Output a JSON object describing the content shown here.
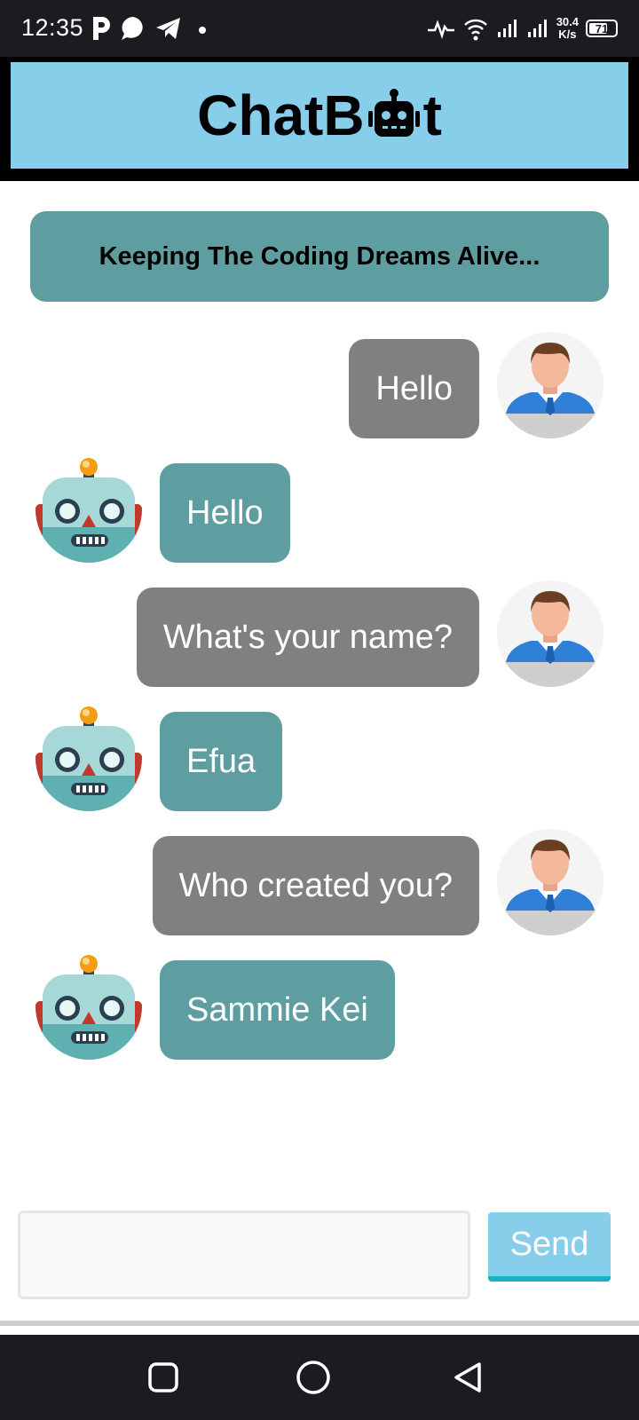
{
  "status_bar": {
    "time": "12:35",
    "net_speed_value": "30.4",
    "net_speed_unit": "K/s",
    "battery": "71",
    "icons": [
      "parking-icon",
      "chat-bubble-icon",
      "telegram-icon",
      "dot-icon",
      "activity-icon",
      "wifi-icon",
      "signal-1-icon",
      "signal-2-icon",
      "battery-icon"
    ]
  },
  "header": {
    "title_before": "ChatB",
    "title_after": "t",
    "robot_icon": "robot-face-icon"
  },
  "tagline": "Keeping The Coding Dreams Alive...",
  "messages": [
    {
      "sender": "user",
      "text": "Hello"
    },
    {
      "sender": "bot",
      "text": "Hello"
    },
    {
      "sender": "user",
      "text": "What's your name?"
    },
    {
      "sender": "bot",
      "text": "Efua"
    },
    {
      "sender": "user",
      "text": "Who created you?"
    },
    {
      "sender": "bot",
      "text": "Sammie Kei"
    }
  ],
  "input": {
    "value": "",
    "placeholder": ""
  },
  "send_button_label": "Send",
  "colors": {
    "header_bg": "#87ceeb",
    "tagline_bg": "#5f9ea0",
    "user_bubble": "#808080",
    "bot_bubble": "#5f9ea0",
    "send_bg": "#87ceeb",
    "system_bar": "#1c1b20"
  },
  "nav_bar": {
    "icons": [
      "recents-square-icon",
      "home-circle-icon",
      "back-triangle-icon"
    ]
  }
}
